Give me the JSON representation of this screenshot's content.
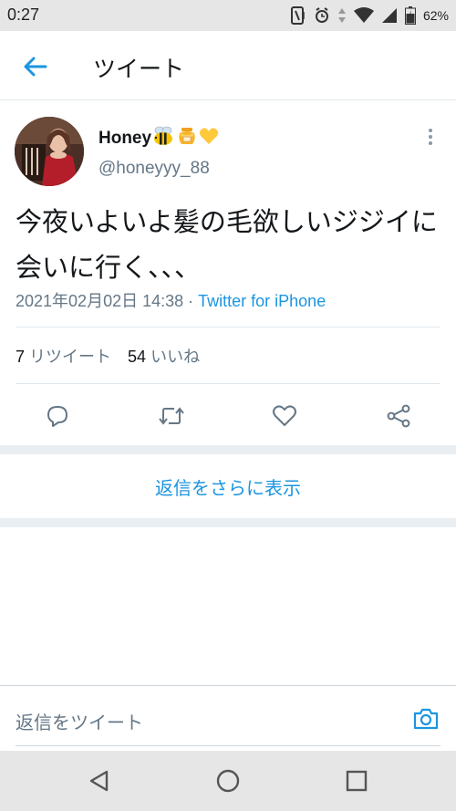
{
  "status_bar": {
    "time": "0:27",
    "battery": "62%",
    "icons": [
      "nfc-icon",
      "alarm-icon",
      "data-arrows-icon",
      "wifi-icon",
      "signal-icon",
      "battery-icon"
    ]
  },
  "header": {
    "back_icon": "arrow-left-icon",
    "title": "ツイート"
  },
  "tweet": {
    "author": {
      "name": "Honey",
      "name_emojis": [
        "bee-emoji",
        "honey-pot-emoji",
        "yellow-heart-emoji"
      ],
      "handle": "@honeyyy_88"
    },
    "text": "今夜いよいよ髪の毛欲しいジジイに会いに行く、、、",
    "timestamp": "2021年02月02日 14:38",
    "separator": " · ",
    "client": "Twitter for iPhone",
    "retweet_count": "7",
    "retweet_label": "リツイート",
    "like_count": "54",
    "like_label": "いいね",
    "actions": [
      "reply-icon",
      "retweet-icon",
      "like-icon",
      "share-icon"
    ]
  },
  "show_more_replies": "返信をさらに表示",
  "reply_box": {
    "placeholder": "返信をツイート",
    "camera_icon": "camera-icon"
  },
  "nav_bar": [
    "back-triangle-icon",
    "home-circle-icon",
    "recents-square-icon"
  ],
  "colors": {
    "accent": "#1b95e0",
    "secondary_text": "#657786",
    "divider": "#e1e8ed",
    "system_bar": "#e6e6e6"
  }
}
